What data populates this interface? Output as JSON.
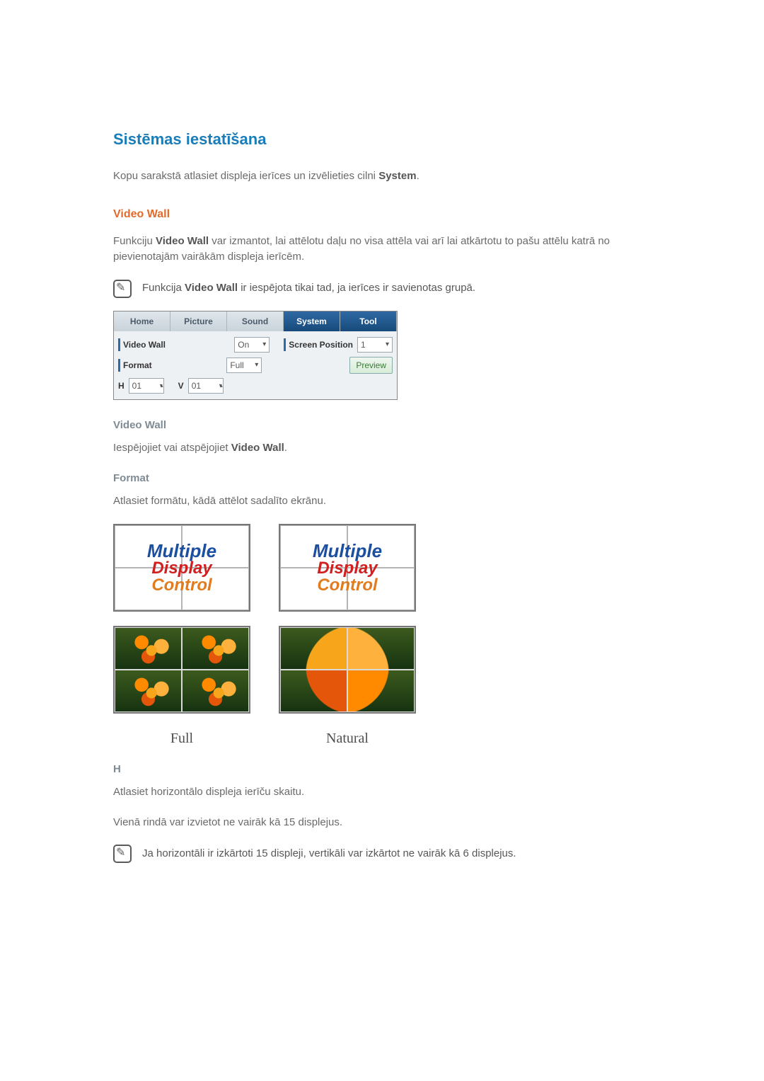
{
  "headings": {
    "main": "Sistēmas iestatīšana",
    "video_wall": "Video Wall",
    "video_wall_sub": "Video Wall",
    "format_sub": "Format",
    "h_sub": "H"
  },
  "paragraphs": {
    "intro_before": "Kopu sarakstā atlasiet displeja ierīces un izvēlieties cilni ",
    "intro_bold": "System",
    "intro_after": ".",
    "vw_before": "Funkciju ",
    "vw_bold": "Video Wall",
    "vw_after": " var izmantot, lai attēlotu daļu no visa attēla vai arī lai atkārtotu to pašu attēlu katrā no pievienotajām vairākām displeja ierīcēm.",
    "note1_before": "Funkcija ",
    "note1_bold": "Video Wall",
    "note1_after": " ir iespējota tikai tad, ja ierīces ir savienotas grupā.",
    "enable_before": "Iespējojiet vai atspējojiet ",
    "enable_bold": "Video Wall",
    "enable_after": ".",
    "format_text": "Atlasiet formātu, kādā attēlot sadalīto ekrānu.",
    "h_text": "Atlasiet horizontālo displeja ierīču skaitu.",
    "h_text2": "Vienā rindā var izvietot ne vairāk kā 15 displejus.",
    "note2": "Ja horizontāli ir izkārtoti 15 displeji, vertikāli var izkārtot ne vairāk kā 6 displejus."
  },
  "tabs": {
    "home": "Home",
    "picture": "Picture",
    "sound": "Sound",
    "system": "System",
    "tool": "Tool"
  },
  "panel": {
    "video_wall_label": "Video Wall",
    "video_wall_value": "On",
    "screen_position_label": "Screen Position",
    "screen_position_value": "1",
    "format_label": "Format",
    "format_value": "Full",
    "h_label": "H",
    "h_value": "01",
    "v_label": "V",
    "v_value": "01",
    "preview": "Preview"
  },
  "overlay": {
    "l1": "Multiple",
    "l2": "Display",
    "l3": "Control"
  },
  "captions": {
    "full": "Full",
    "natural": "Natural"
  }
}
